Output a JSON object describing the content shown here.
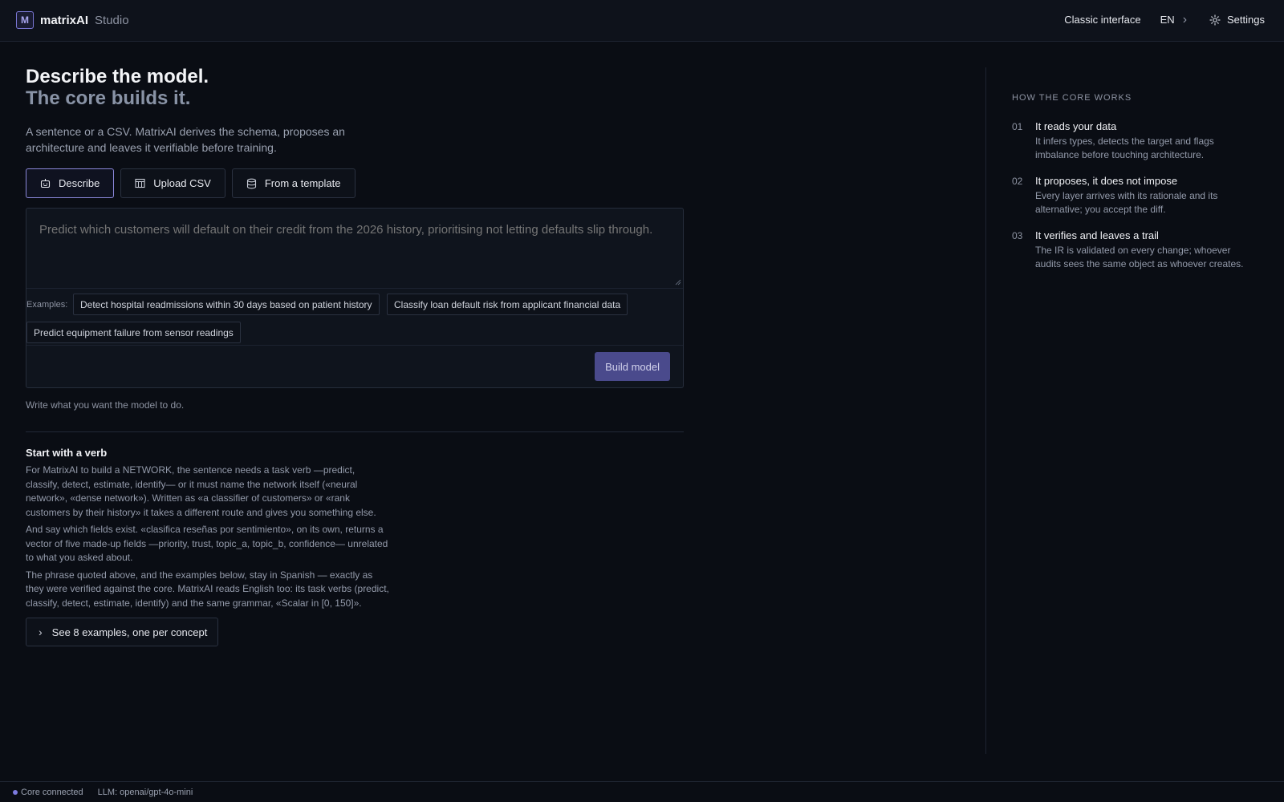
{
  "header": {
    "logo_letter": "M",
    "brand": "matrixAI",
    "product": "Studio",
    "classic_link": "Classic interface",
    "language": "EN",
    "settings_label": "Settings"
  },
  "hero": {
    "title_line1": "Describe the model.",
    "title_line2": "The core builds it.",
    "lead": "A sentence or a CSV. MatrixAI derives the schema, proposes an architecture and leaves it verifiable before training."
  },
  "tabs": [
    {
      "label": "Describe",
      "icon": "robot-icon",
      "active": true
    },
    {
      "label": "Upload CSV",
      "icon": "table-icon",
      "active": false
    },
    {
      "label": "From a template",
      "icon": "database-icon",
      "active": false
    }
  ],
  "composer": {
    "placeholder": "Predict which customers will default on their credit from the 2026 history, prioritising not letting defaults slip through.",
    "examples_label": "Examples:",
    "examples": [
      "Detect hospital readmissions within 30 days based on patient history",
      "Classify loan default risk from applicant financial data",
      "Predict equipment failure from sensor readings"
    ],
    "build_label": "Build model",
    "hint": "Write what you want the model to do."
  },
  "guide": {
    "title": "Start with a verb",
    "paragraphs": [
      "For MatrixAI to build a NETWORK, the sentence needs a task verb —predict, classify, detect, estimate, identify— or it must name the network itself («neural network», «dense network»). Written as «a classifier of customers» or «rank customers by their history» it takes a different route and gives you something else.",
      "And say which fields exist. «clasifica reseñas por sentimiento», on its own, returns a vector of five made-up fields —priority, trust, topic_a, topic_b, confidence— unrelated to what you asked about.",
      "The phrase quoted above, and the examples below, stay in Spanish — exactly as they were verified against the core. MatrixAI reads English too: its task verbs (predict, classify, detect, estimate, identify) and the same grammar, «Scalar in [0, 150]»."
    ],
    "see_examples_label": "See 8 examples, one per concept"
  },
  "how": {
    "title": "HOW THE CORE WORKS",
    "steps": [
      {
        "num": "01",
        "title": "It reads your data",
        "desc": "It infers types, detects the target and flags imbalance before touching architecture."
      },
      {
        "num": "02",
        "title": "It proposes, it does not impose",
        "desc": "Every layer arrives with its rationale and its alternative; you accept the diff."
      },
      {
        "num": "03",
        "title": "It verifies and leaves a trail",
        "desc": "The IR is validated on every change; whoever audits sees the same object as whoever creates."
      }
    ]
  },
  "status": {
    "connection": "Core connected",
    "llm": "LLM: openai/gpt-4o-mini"
  },
  "colors": {
    "background": "#0a0d14",
    "accent": "#7d7be0",
    "build_button": "#4a4a8c"
  }
}
